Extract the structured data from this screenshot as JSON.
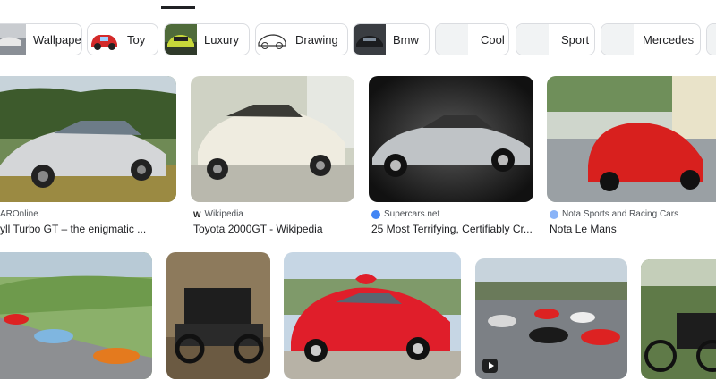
{
  "chips": [
    {
      "label": "Wallpaper",
      "icon": "car-thumbnail"
    },
    {
      "label": "Toy",
      "icon": "toy-car-thumbnail"
    },
    {
      "label": "Luxury",
      "icon": "car-thumbnail"
    },
    {
      "label": "Drawing",
      "icon": "car-drawing-thumbnail"
    },
    {
      "label": "Bmw",
      "icon": "car-thumbnail"
    },
    {
      "label": "Cool",
      "icon": "placeholder"
    },
    {
      "label": "Sport",
      "icon": "placeholder"
    },
    {
      "label": "Mercedes",
      "icon": "placeholder"
    }
  ],
  "results_row1": [
    {
      "source": "AROnline",
      "title": "yll Turbo GT – the enigmatic ...",
      "favicon_color": "#1a73e8"
    },
    {
      "source": "Wikipedia",
      "favicon_glyph": "W",
      "title": "Toyota 2000GT - Wikipedia"
    },
    {
      "source": "Supercars.net",
      "title": "25 Most Terrifying, Certifiably Cr...",
      "favicon_color": "#4285f4"
    },
    {
      "source": "Nota Sports and Racing Cars",
      "title": "Nota Le Mans",
      "favicon_color": "#8ab4f8"
    }
  ],
  "colors": {
    "chip_border": "#dadce0",
    "text": "#202124",
    "muted": "#4d5156"
  }
}
